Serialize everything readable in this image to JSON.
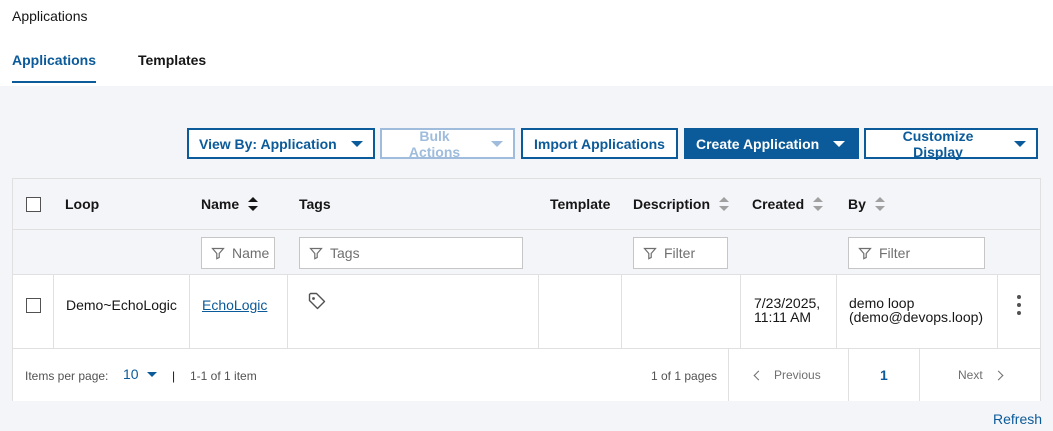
{
  "header": {
    "title": "Applications",
    "tabs": [
      {
        "label": "Applications",
        "active": true
      },
      {
        "label": "Templates",
        "active": false
      }
    ]
  },
  "toolbar": {
    "view_by": "View By: Application",
    "bulk_actions": "Bulk Actions",
    "import": "Import Applications",
    "create": "Create Application",
    "customize": "Customize Display"
  },
  "table": {
    "columns": {
      "loop": "Loop",
      "name": "Name",
      "tags": "Tags",
      "template": "Template",
      "description": "Description",
      "created": "Created",
      "by": "By"
    },
    "filters": {
      "name_placeholder": "Name",
      "tags_placeholder": "Tags",
      "description_placeholder": "Filter",
      "by_placeholder": "Filter"
    },
    "rows": [
      {
        "loop": "Demo~EchoLogic",
        "name": "EchoLogic",
        "tags": "",
        "template": "",
        "description": "",
        "created_line1": "7/23/2025,",
        "created_line2": "11:11 AM",
        "by_line1": "demo loop",
        "by_line2": "(demo@devops.loop)"
      }
    ]
  },
  "pagination": {
    "items_per_page_label": "Items per page:",
    "items_per_page": "10",
    "range": "1-1 of 1 item",
    "pages": "1 of 1 pages",
    "previous": "Previous",
    "current_page": "1",
    "next": "Next"
  },
  "footer": {
    "refresh": "Refresh"
  },
  "colors": {
    "accent": "#0b5a99",
    "background": "#f4f5f8"
  }
}
